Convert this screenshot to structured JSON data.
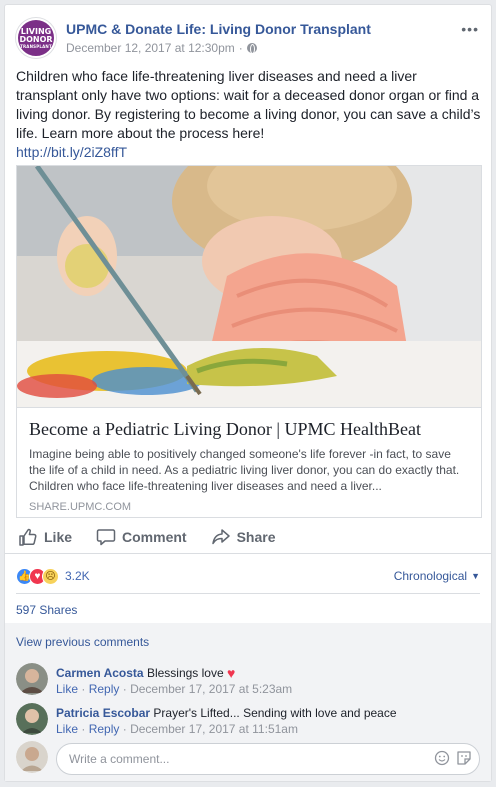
{
  "post": {
    "logo_lines": [
      "LIVING",
      "DONOR",
      "TRANSPLANT"
    ],
    "page_name": "UPMC & Donate Life: Living Donor Transplant",
    "timestamp": "December 12, 2017 at 12:30pm",
    "separator": "·",
    "text": "Children who face life-threatening liver diseases and need a liver transplant only have two options: wait for a deceased donor organ or find a living donor. By registering to become a living donor, you can save a child’s life. Learn more about the process here!",
    "link": "http://bit.ly/2iZ8ffT",
    "attachment": {
      "title": "Become a Pediatric Living Donor | UPMC HealthBeat",
      "description": "Imagine being able to positively changed someone's life forever -in fact, to save the life of a child in need. As a pediatric living liver donor, you can do exactly that. Children who face life-threatening liver diseases and need a liver...",
      "domain": "SHARE.UPMC.COM"
    }
  },
  "actions": {
    "like": "Like",
    "comment": "Comment",
    "share": "Share"
  },
  "reactions": {
    "count": "3.2K",
    "types": [
      "like-icon",
      "love-icon",
      "sad-icon"
    ],
    "order": "Chronological"
  },
  "shares": "597 Shares",
  "comments": {
    "view_previous": "View previous comments",
    "items": [
      {
        "name": "Carmen Acosta",
        "text": "Blessings love",
        "like": "Like",
        "reply": "Reply",
        "sep": "·",
        "time": "December 17, 2017 at 5:23am"
      },
      {
        "name": "Patricia Escobar",
        "text": "Prayer's Lifted... Sending with love and peace",
        "like": "Like",
        "reply": "Reply",
        "sep": "·",
        "time": "December 17, 2017 at 11:51am"
      }
    ],
    "placeholder": "Write a comment..."
  },
  "colors": {
    "link": "#365899",
    "meta": "#90949c",
    "brand_purple": "#7b2f87"
  }
}
